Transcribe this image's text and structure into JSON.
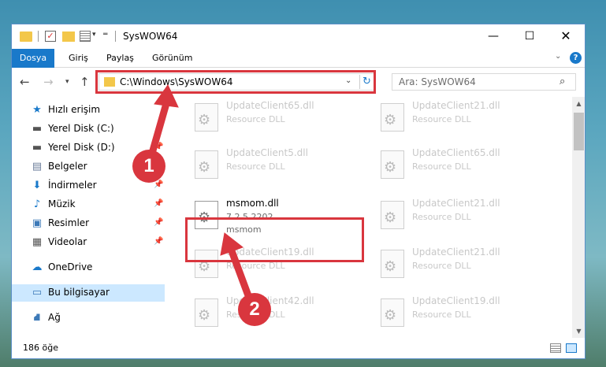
{
  "window": {
    "title": "SysWOW64",
    "controls": {
      "minimize": "—",
      "maximize": "☐",
      "close": "✕"
    }
  },
  "ribbon": {
    "tabs": [
      "Dosya",
      "Giriş",
      "Paylaş",
      "Görünüm"
    ]
  },
  "nav": {
    "address": "C:\\Windows\\SysWOW64",
    "search_placeholder": "Ara: SysWOW64"
  },
  "sidebar": {
    "items": [
      {
        "label": "Hızlı erişim",
        "icon": "star-icon"
      },
      {
        "label": "Yerel Disk (C:)",
        "icon": "drive-icon"
      },
      {
        "label": "Yerel Disk (D:)",
        "icon": "drive-icon"
      },
      {
        "label": "Belgeler",
        "icon": "documents-icon"
      },
      {
        "label": "İndirmeler",
        "icon": "download-icon"
      },
      {
        "label": "Müzik",
        "icon": "music-icon"
      },
      {
        "label": "Resimler",
        "icon": "pictures-icon"
      },
      {
        "label": "Videolar",
        "icon": "videos-icon"
      },
      {
        "label": "OneDrive",
        "icon": "cloud-icon"
      },
      {
        "label": "Bu bilgisayar",
        "icon": "computer-icon"
      },
      {
        "label": "Ağ",
        "icon": "network-icon"
      }
    ]
  },
  "files": [
    {
      "name": "UpdateClient65.dll",
      "desc": "Resource DLL"
    },
    {
      "name": "UpdateClient21.dll",
      "desc": "Resource DLL"
    },
    {
      "name": "UpdateClient5.dll",
      "desc": "Resource DLL"
    },
    {
      "name": "UpdateClient65.dll",
      "desc": "Resource DLL"
    },
    {
      "name": "msmom.dll",
      "version": "7.2.5.2202",
      "desc": "msmom"
    },
    {
      "name": "UpdateClient21.dll",
      "desc": "Resource DLL"
    },
    {
      "name": "UpdateClient19.dll",
      "desc": "Resource DLL"
    },
    {
      "name": "UpdateClient21.dll",
      "desc": "Resource DLL"
    },
    {
      "name": "UpdateClient42.dll",
      "desc": "Resource DLL"
    },
    {
      "name": "UpdateClient19.dll",
      "desc": "Resource DLL"
    }
  ],
  "status": {
    "count": "186 öğe"
  },
  "callouts": [
    "1",
    "2"
  ],
  "colors": {
    "accent": "#1979ca",
    "highlight": "#d9363e",
    "selection": "#cce8ff"
  }
}
